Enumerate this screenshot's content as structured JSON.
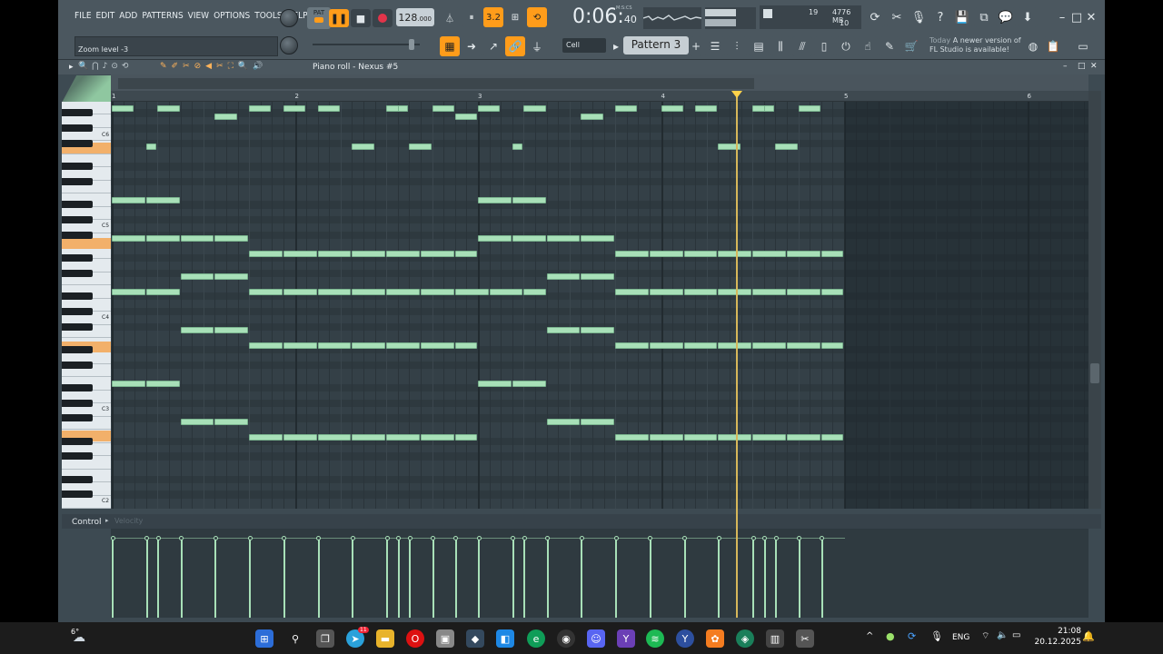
{
  "menu": [
    "FILE",
    "EDIT",
    "ADD",
    "PATTERNS",
    "VIEW",
    "OPTIONS",
    "TOOLS",
    "HELP"
  ],
  "hint": "Zoom level -3",
  "transport": {
    "pat_label": "PAT",
    "tempo": "128",
    "tempo_frac": ".000",
    "time": "0:06",
    "time_sub": "40",
    "time_unit": "M:S:CS",
    "song_mode": "3.2"
  },
  "cpu": {
    "voices": "19",
    "memory": "4776 MB",
    "polyphony": "10"
  },
  "cell_label": "Cell",
  "pattern": "Pattern 3",
  "news": {
    "when": "Today",
    "text1": "A newer version of",
    "text2": "FL Studio is available!"
  },
  "window_title": "Piano roll - Nexus #5",
  "bars": [
    "1",
    "2",
    "3",
    "4",
    "5",
    "6"
  ],
  "key_labels": [
    "C6",
    "C5",
    "C4",
    "C3",
    "C2"
  ],
  "control": {
    "label": "Control",
    "field": "Velocity"
  },
  "taskbar": {
    "temp": "6°",
    "lang": "ENG",
    "time": "21:08",
    "date": "20.12.2025",
    "badge": "11"
  },
  "colors": {
    "accent": "#ff9c1a",
    "note": "#a8e0b8",
    "playhead": "#d7b75a"
  }
}
